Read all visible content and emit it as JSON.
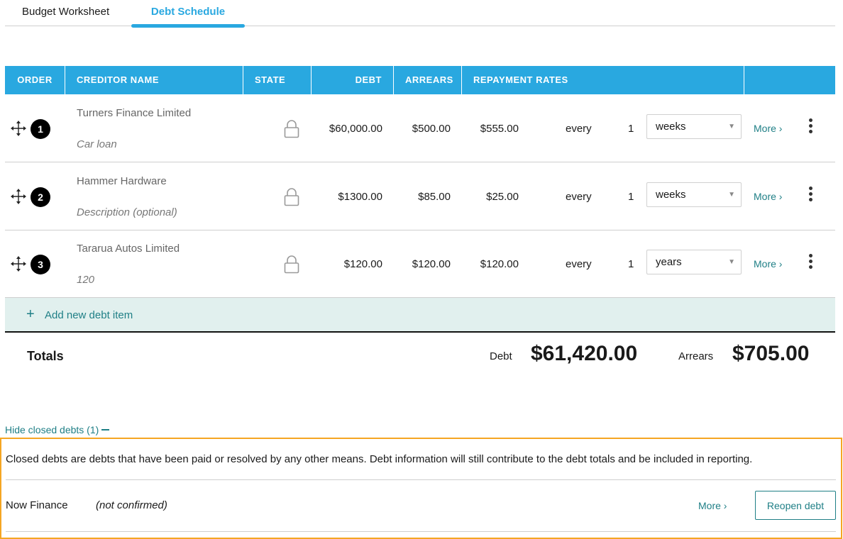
{
  "tabs": [
    {
      "label": "Budget Worksheet",
      "active": false
    },
    {
      "label": "Debt Schedule",
      "active": true
    }
  ],
  "table": {
    "headers": {
      "order": "ORDER",
      "creditor": "CREDITOR NAME",
      "state": "STATE",
      "debt": "DEBT",
      "arrears": "ARREARS",
      "rates": "REPAYMENT RATES"
    },
    "rows": [
      {
        "order": "1",
        "creditor": "Turners Finance Limited",
        "description": "Car loan",
        "debt": "$60,000.00",
        "arrears": "$500.00",
        "rate": "$555.00",
        "every": "every",
        "frequency": "1",
        "period": "weeks",
        "more": "More"
      },
      {
        "order": "2",
        "creditor": "Hammer Hardware",
        "description": "Description (optional)",
        "debt": "$1300.00",
        "arrears": "$85.00",
        "rate": "$25.00",
        "every": "every",
        "frequency": "1",
        "period": "weeks",
        "more": "More"
      },
      {
        "order": "3",
        "creditor": "Tararua Autos Limited",
        "description": "120",
        "debt": "$120.00",
        "arrears": "$120.00",
        "rate": "$120.00",
        "every": "every",
        "frequency": "1",
        "period": "years",
        "more": "More"
      }
    ],
    "add_label": "Add new debt item"
  },
  "totals": {
    "label": "Totals",
    "debt_label": "Debt",
    "debt_value": "$61,420.00",
    "arrears_label": "Arrears",
    "arrears_value": "$705.00"
  },
  "closed": {
    "toggle_label": "Hide closed debts (1)",
    "info": "Closed debts are debts that have been paid or resolved by any other means. Debt information will still contribute to the debt totals and be included in reporting.",
    "items": [
      {
        "name": "Now Finance",
        "status": "(not confirmed)",
        "more": "More",
        "reopen": "Reopen debt"
      }
    ]
  },
  "colors": {
    "accent": "#29a8e0",
    "teal": "#1f7f86",
    "highlight": "#f5a623",
    "add_row_bg": "#e1f0ee"
  }
}
